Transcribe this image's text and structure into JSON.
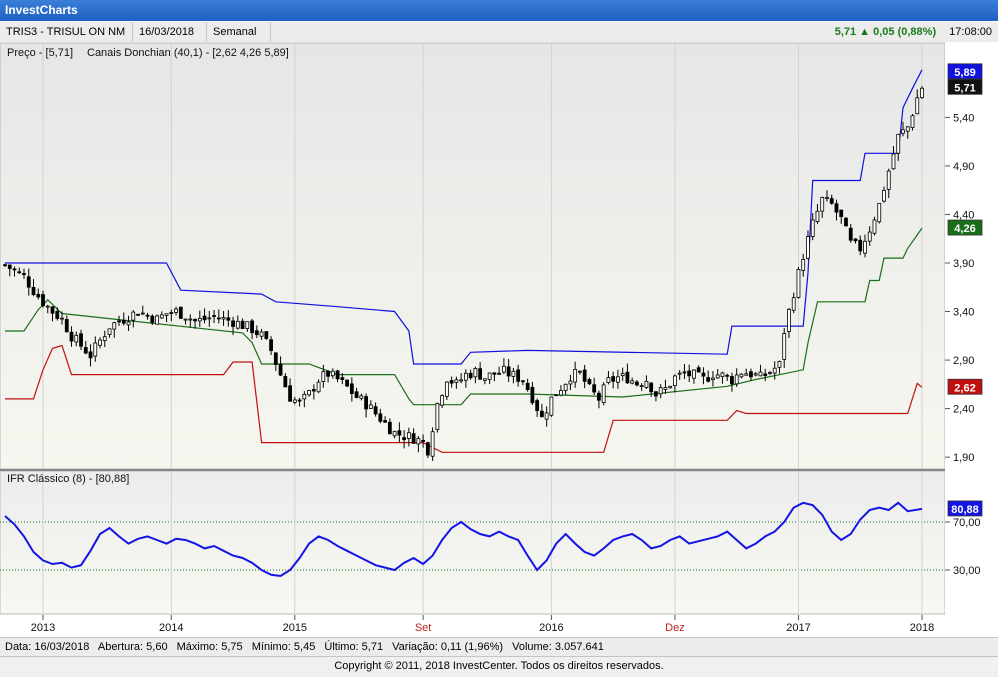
{
  "app": {
    "title": "InvestCharts"
  },
  "info": {
    "symbol": "TRIS3 - TRISUL ON NM",
    "date": "16/03/2018",
    "period": "Semanal",
    "change": "5,71 ▲ 0,05 (0,88%)",
    "time": "17:08:00"
  },
  "price_panel": {
    "legend_price": "Preço - [5,71]",
    "legend_donchian": "Canais Donchian (40,1) - [2,62  4,26  5,89]"
  },
  "rsi_panel": {
    "legend": "IFR Clássico (8) - [80,88]"
  },
  "status": {
    "data": "Data: 16/03/2018",
    "abertura": "Abertura: 5,60",
    "maximo": "Máximo: 5,75",
    "minimo": "Mínimo: 5,45",
    "ultimo": "Último: 5,71",
    "variacao": "Variação: 0,11 (1,96%)",
    "volume": "Volume: 3.057.641"
  },
  "footer": {
    "copyright": "Copyright © 2011, 2018  InvestCenter. Todos os direitos reservados."
  },
  "colors": {
    "upper": "#1010e0",
    "middle": "#1a6e1a",
    "lower": "#c01010",
    "rsi": "#1414e6",
    "candle": "#000000"
  },
  "chart_data": [
    {
      "type": "candlestick",
      "title": "Preço",
      "y_ticks": [
        "5,40",
        "4,90",
        "4,40",
        "3,90",
        "3,40",
        "2,90",
        "2,40",
        "1,90"
      ],
      "ylim": [
        1.85,
        5.95
      ],
      "x_ticks": [
        "2013",
        "2014",
        "2015",
        "Set",
        "2016",
        "Dez",
        "2017",
        "2018"
      ],
      "labels": {
        "upper": "5,89",
        "last": "5,71",
        "middle": "4,26",
        "lower": "2,62"
      },
      "series": [
        {
          "name": "Preço",
          "values": [
            [
              0,
              3.88
            ],
            [
              2,
              3.82
            ],
            [
              4,
              3.76
            ],
            [
              6,
              3.62
            ],
            [
              8,
              3.5
            ],
            [
              10,
              3.4
            ],
            [
              12,
              3.32
            ],
            [
              14,
              3.15
            ],
            [
              16,
              3.05
            ],
            [
              18,
              2.95
            ],
            [
              20,
              3.1
            ],
            [
              22,
              3.25
            ],
            [
              24,
              3.3
            ],
            [
              26,
              3.35
            ],
            [
              28,
              3.4
            ],
            [
              30,
              3.36
            ],
            [
              32,
              3.32
            ],
            [
              34,
              3.38
            ],
            [
              36,
              3.4
            ],
            [
              38,
              3.36
            ],
            [
              40,
              3.3
            ],
            [
              42,
              3.32
            ],
            [
              44,
              3.35
            ],
            [
              46,
              3.32
            ],
            [
              48,
              3.3
            ],
            [
              50,
              3.26
            ],
            [
              52,
              3.22
            ],
            [
              54,
              3.15
            ],
            [
              56,
              3.0
            ],
            [
              58,
              2.75
            ],
            [
              60,
              2.52
            ],
            [
              62,
              2.45
            ],
            [
              64,
              2.55
            ],
            [
              66,
              2.7
            ],
            [
              68,
              2.76
            ],
            [
              70,
              2.7
            ],
            [
              72,
              2.62
            ],
            [
              74,
              2.52
            ],
            [
              76,
              2.45
            ],
            [
              78,
              2.35
            ],
            [
              80,
              2.25
            ],
            [
              82,
              2.15
            ],
            [
              84,
              2.12
            ],
            [
              86,
              2.1
            ],
            [
              88,
              2.05
            ],
            [
              89,
              1.98
            ],
            [
              91,
              2.45
            ],
            [
              93,
              2.72
            ],
            [
              95,
              2.65
            ],
            [
              97,
              2.75
            ],
            [
              99,
              2.78
            ],
            [
              101,
              2.72
            ],
            [
              103,
              2.76
            ],
            [
              105,
              2.78
            ],
            [
              107,
              2.74
            ],
            [
              109,
              2.7
            ],
            [
              111,
              2.52
            ],
            [
              113,
              2.3
            ],
            [
              115,
              2.5
            ],
            [
              117,
              2.62
            ],
            [
              119,
              2.74
            ],
            [
              121,
              2.76
            ],
            [
              123,
              2.6
            ],
            [
              125,
              2.5
            ],
            [
              127,
              2.68
            ],
            [
              129,
              2.72
            ],
            [
              131,
              2.72
            ],
            [
              133,
              2.66
            ],
            [
              135,
              2.7
            ],
            [
              137,
              2.55
            ],
            [
              139,
              2.6
            ],
            [
              141,
              2.72
            ],
            [
              143,
              2.76
            ],
            [
              145,
              2.74
            ],
            [
              147,
              2.7
            ],
            [
              149,
              2.76
            ],
            [
              151,
              2.74
            ],
            [
              153,
              2.7
            ],
            [
              155,
              2.78
            ],
            [
              157,
              2.76
            ],
            [
              159,
              2.72
            ],
            [
              161,
              2.78
            ],
            [
              163,
              2.85
            ],
            [
              164,
              3.2
            ],
            [
              166,
              3.6
            ],
            [
              168,
              3.98
            ],
            [
              170,
              4.3
            ],
            [
              172,
              4.55
            ],
            [
              174,
              4.5
            ],
            [
              176,
              4.35
            ],
            [
              178,
              4.1
            ],
            [
              180,
              4.05
            ],
            [
              182,
              4.25
            ],
            [
              184,
              4.5
            ],
            [
              186,
              4.85
            ],
            [
              188,
              5.2
            ],
            [
              190,
              5.3
            ],
            [
              192,
              5.6
            ],
            [
              193,
              5.71
            ]
          ]
        },
        {
          "name": "Canal superior",
          "values": [
            [
              0,
              3.9
            ],
            [
              34,
              3.9
            ],
            [
              37,
              3.62
            ],
            [
              54,
              3.58
            ],
            [
              57,
              3.5
            ],
            [
              70,
              3.45
            ],
            [
              82,
              3.4
            ],
            [
              85,
              3.2
            ],
            [
              86,
              2.86
            ],
            [
              96,
              2.86
            ],
            [
              98,
              2.98
            ],
            [
              110,
              3.0
            ],
            [
              152,
              2.96
            ],
            [
              153,
              3.25
            ],
            [
              168,
              3.25
            ],
            [
              169,
              3.8
            ],
            [
              170,
              4.75
            ],
            [
              180,
              4.75
            ],
            [
              181,
              5.03
            ],
            [
              188,
              5.03
            ],
            [
              189,
              5.5
            ],
            [
              191,
              5.7
            ],
            [
              193,
              5.89
            ]
          ]
        },
        {
          "name": "Canal médio",
          "values": [
            [
              0,
              3.2
            ],
            [
              4,
              3.2
            ],
            [
              7,
              3.42
            ],
            [
              9,
              3.52
            ],
            [
              12,
              3.38
            ],
            [
              50,
              3.18
            ],
            [
              52,
              3.08
            ],
            [
              54,
              2.86
            ],
            [
              64,
              2.86
            ],
            [
              70,
              2.75
            ],
            [
              82,
              2.75
            ],
            [
              85,
              2.5
            ],
            [
              86,
              2.44
            ],
            [
              96,
              2.44
            ],
            [
              98,
              2.55
            ],
            [
              110,
              2.55
            ],
            [
              130,
              2.52
            ],
            [
              152,
              2.63
            ],
            [
              158,
              2.7
            ],
            [
              168,
              2.8
            ],
            [
              169,
              3.08
            ],
            [
              171,
              3.5
            ],
            [
              181,
              3.5
            ],
            [
              182,
              3.72
            ],
            [
              184,
              3.72
            ],
            [
              185,
              3.95
            ],
            [
              189,
              3.95
            ],
            [
              190,
              4.05
            ],
            [
              193,
              4.26
            ]
          ]
        },
        {
          "name": "Canal inferior",
          "values": [
            [
              0,
              2.5
            ],
            [
              6,
              2.5
            ],
            [
              8,
              2.8
            ],
            [
              10,
              3.02
            ],
            [
              12,
              3.05
            ],
            [
              14,
              2.75
            ],
            [
              46,
              2.75
            ],
            [
              48,
              2.88
            ],
            [
              52,
              2.88
            ],
            [
              54,
              2.05
            ],
            [
              88,
              2.05
            ],
            [
              92,
              1.95
            ],
            [
              126,
              1.95
            ],
            [
              128,
              2.28
            ],
            [
              152,
              2.28
            ],
            [
              154,
              2.38
            ],
            [
              156,
              2.35
            ],
            [
              190,
              2.35
            ],
            [
              192,
              2.66
            ],
            [
              193,
              2.62
            ]
          ]
        }
      ]
    },
    {
      "type": "line",
      "title": "IFR Clássico (8)",
      "y_ticks": [
        "70,00",
        "30,00"
      ],
      "ylim": [
        0,
        100
      ],
      "x_ticks": [
        "2013",
        "2014",
        "2015",
        "Set",
        "2016",
        "Dez",
        "2017",
        "2018"
      ],
      "labels": {
        "last": "80,88"
      },
      "series": [
        {
          "name": "IFR",
          "values": [
            [
              0,
              75
            ],
            [
              2,
              68
            ],
            [
              4,
              58
            ],
            [
              6,
              45
            ],
            [
              8,
              38
            ],
            [
              10,
              35
            ],
            [
              12,
              36
            ],
            [
              14,
              32
            ],
            [
              16,
              34
            ],
            [
              18,
              46
            ],
            [
              20,
              60
            ],
            [
              22,
              65
            ],
            [
              24,
              58
            ],
            [
              26,
              52
            ],
            [
              28,
              56
            ],
            [
              30,
              58
            ],
            [
              32,
              55
            ],
            [
              34,
              52
            ],
            [
              36,
              56
            ],
            [
              38,
              55
            ],
            [
              40,
              52
            ],
            [
              42,
              48
            ],
            [
              44,
              50
            ],
            [
              46,
              46
            ],
            [
              48,
              42
            ],
            [
              50,
              40
            ],
            [
              52,
              36
            ],
            [
              54,
              30
            ],
            [
              56,
              26
            ],
            [
              58,
              25
            ],
            [
              60,
              30
            ],
            [
              62,
              40
            ],
            [
              64,
              52
            ],
            [
              66,
              58
            ],
            [
              68,
              55
            ],
            [
              70,
              50
            ],
            [
              72,
              46
            ],
            [
              74,
              42
            ],
            [
              76,
              38
            ],
            [
              78,
              34
            ],
            [
              80,
              32
            ],
            [
              82,
              30
            ],
            [
              84,
              36
            ],
            [
              86,
              40
            ],
            [
              88,
              35
            ],
            [
              90,
              42
            ],
            [
              92,
              55
            ],
            [
              94,
              65
            ],
            [
              96,
              70
            ],
            [
              98,
              64
            ],
            [
              100,
              60
            ],
            [
              102,
              58
            ],
            [
              104,
              62
            ],
            [
              106,
              58
            ],
            [
              108,
              55
            ],
            [
              110,
              42
            ],
            [
              112,
              30
            ],
            [
              114,
              38
            ],
            [
              116,
              52
            ],
            [
              118,
              60
            ],
            [
              120,
              52
            ],
            [
              122,
              45
            ],
            [
              124,
              42
            ],
            [
              126,
              48
            ],
            [
              128,
              55
            ],
            [
              130,
              58
            ],
            [
              132,
              60
            ],
            [
              134,
              55
            ],
            [
              136,
              48
            ],
            [
              138,
              50
            ],
            [
              140,
              55
            ],
            [
              142,
              58
            ],
            [
              144,
              52
            ],
            [
              146,
              54
            ],
            [
              148,
              56
            ],
            [
              150,
              58
            ],
            [
              152,
              62
            ],
            [
              154,
              55
            ],
            [
              156,
              48
            ],
            [
              158,
              52
            ],
            [
              160,
              58
            ],
            [
              162,
              62
            ],
            [
              164,
              70
            ],
            [
              166,
              82
            ],
            [
              168,
              86
            ],
            [
              170,
              84
            ],
            [
              172,
              76
            ],
            [
              174,
              62
            ],
            [
              176,
              55
            ],
            [
              178,
              60
            ],
            [
              180,
              72
            ],
            [
              182,
              80
            ],
            [
              184,
              82
            ],
            [
              186,
              80
            ],
            [
              188,
              86
            ],
            [
              190,
              79
            ],
            [
              193,
              80.88
            ]
          ]
        }
      ]
    }
  ]
}
